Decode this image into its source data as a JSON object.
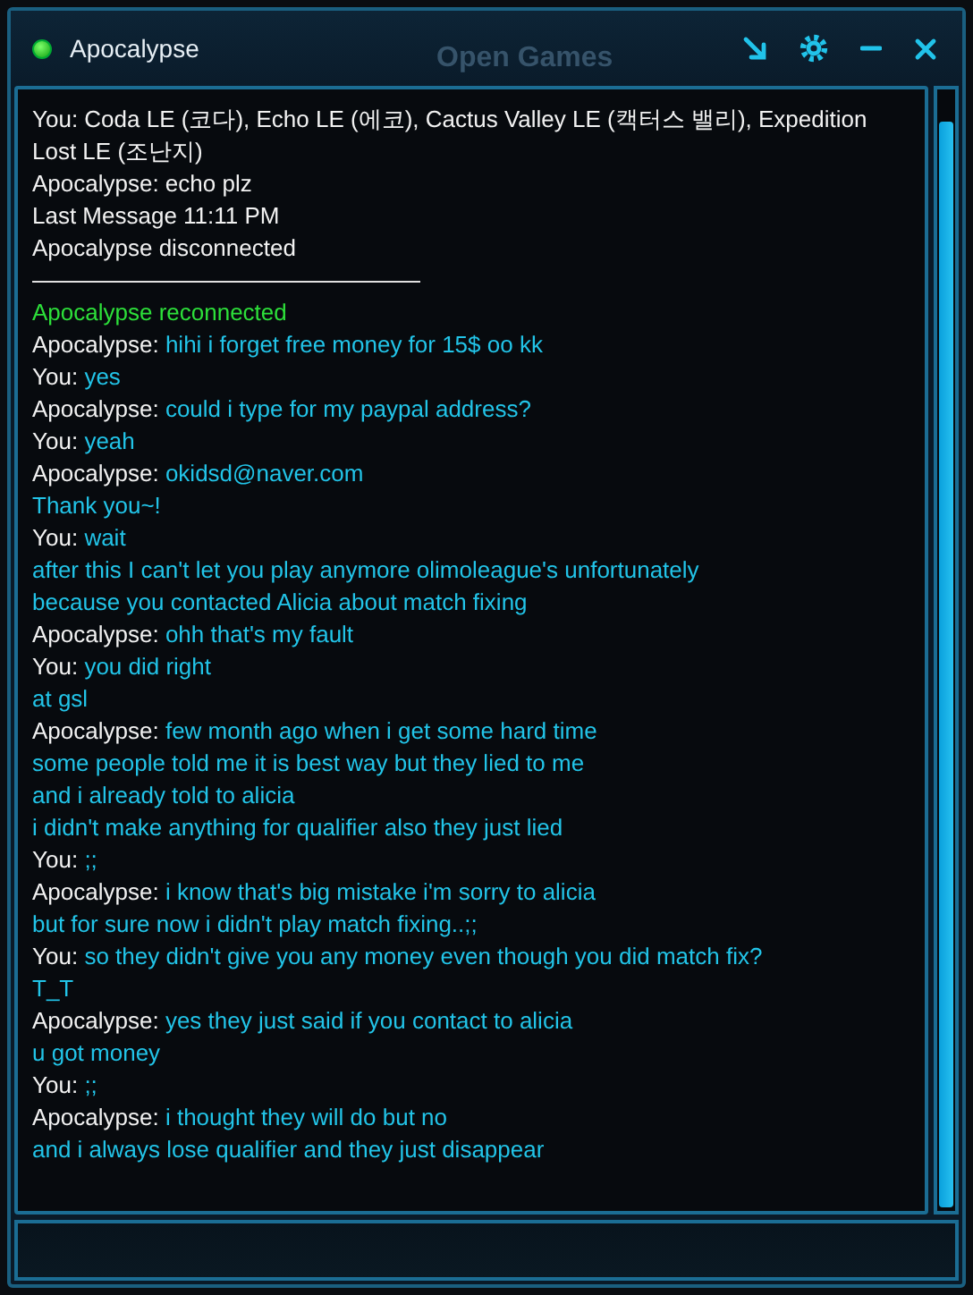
{
  "window": {
    "title": "Apocalypse",
    "online": true,
    "background_text": "Open Games"
  },
  "chat": {
    "lines": [
      {
        "kind": "plain",
        "text": "You: Coda LE (코다), Echo LE (에코), Cactus Valley LE (캑터스 밸리), Expedition Lost LE (조난지)"
      },
      {
        "kind": "plain",
        "text": "Apocalypse: echo plz"
      },
      {
        "kind": "plain",
        "text": "Last Message 11:11 PM"
      },
      {
        "kind": "plain",
        "text": "Apocalypse disconnected"
      },
      {
        "kind": "divider"
      },
      {
        "kind": "status",
        "text": "Apocalypse reconnected"
      },
      {
        "kind": "message",
        "sender": "Apocalypse:",
        "text": "hihi i forget free money for 15$ oo kk"
      },
      {
        "kind": "message",
        "sender": "You:",
        "text": "yes"
      },
      {
        "kind": "message",
        "sender": "Apocalypse:",
        "text": "could i type for my paypal address?"
      },
      {
        "kind": "message",
        "sender": "You:",
        "text": "yeah"
      },
      {
        "kind": "message",
        "sender": "Apocalypse:",
        "text": "okidsd@naver.com"
      },
      {
        "kind": "continuation",
        "text": "Thank you~!"
      },
      {
        "kind": "message",
        "sender": "You:",
        "text": "wait"
      },
      {
        "kind": "continuation",
        "text": "after this I can't let you play anymore olimoleague's unfortunately"
      },
      {
        "kind": "continuation",
        "text": "because you contacted Alicia about match fixing"
      },
      {
        "kind": "message",
        "sender": "Apocalypse:",
        "text": "ohh that's my fault"
      },
      {
        "kind": "message",
        "sender": "You:",
        "text": "you did right"
      },
      {
        "kind": "continuation",
        "text": "at gsl"
      },
      {
        "kind": "message",
        "sender": "Apocalypse:",
        "text": "few month ago when i get some hard time"
      },
      {
        "kind": "continuation",
        "text": "some people told me it is best way but they lied to me"
      },
      {
        "kind": "continuation",
        "text": "and i already told to alicia"
      },
      {
        "kind": "continuation",
        "text": "i didn't make anything for qualifier also they just lied"
      },
      {
        "kind": "message",
        "sender": "You:",
        "text": ";;"
      },
      {
        "kind": "message",
        "sender": "Apocalypse:",
        "text": "i know that's big mistake i'm sorry to alicia"
      },
      {
        "kind": "continuation",
        "text": "but for sure now i didn't play match fixing..;;"
      },
      {
        "kind": "message",
        "sender": "You:",
        "text": "so they didn't give you any money even though you did match fix?"
      },
      {
        "kind": "continuation",
        "text": "T_T"
      },
      {
        "kind": "message",
        "sender": "Apocalypse:",
        "text": "yes they just said if you contact to alicia"
      },
      {
        "kind": "continuation",
        "text": "u got money"
      },
      {
        "kind": "message",
        "sender": "You:",
        "text": ";;"
      },
      {
        "kind": "message",
        "sender": "Apocalypse:",
        "text": "i thought they will do but no"
      },
      {
        "kind": "continuation",
        "text": "and i always lose qualifier and they just disappear"
      }
    ]
  }
}
